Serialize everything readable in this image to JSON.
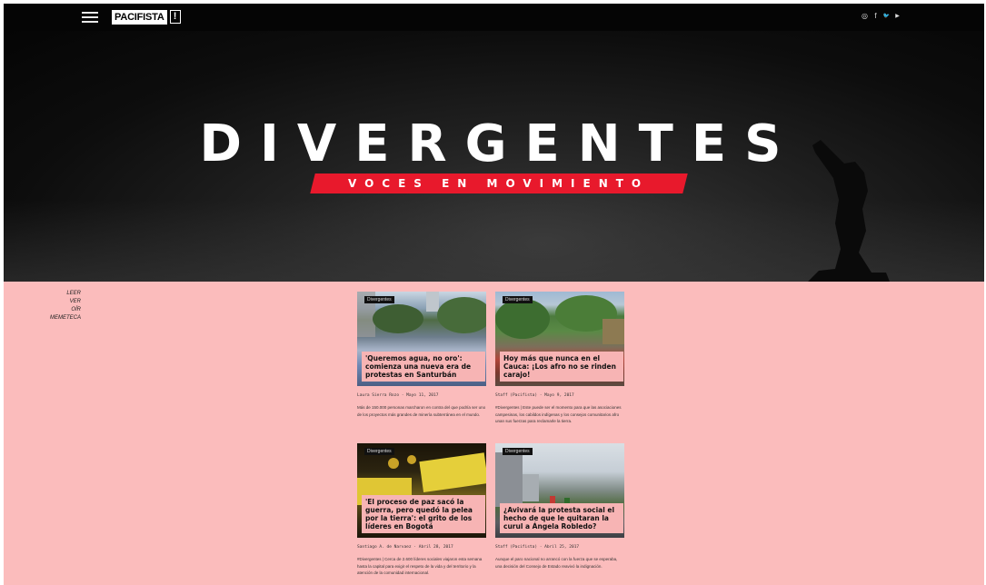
{
  "nav": {
    "logo_text": "PACIFISTA",
    "logo_mark": "!",
    "menu_icon": "hamburger-menu-icon",
    "social": [
      {
        "name": "instagram-icon",
        "glyph": "◎"
      },
      {
        "name": "facebook-icon",
        "glyph": "f"
      },
      {
        "name": "twitter-icon",
        "glyph": "🐦"
      },
      {
        "name": "youtube-icon",
        "glyph": "▶"
      }
    ]
  },
  "hero": {
    "title": "DIVERGENTES",
    "subtitle": "VOCES EN MOVIMIENTO"
  },
  "side_nav": [
    "LEER",
    "VER",
    "OÍR",
    "MEMETECA"
  ],
  "cards": [
    {
      "tag": "Divergentes",
      "headline": "'Queremos agua, no oro': comienza una nueva era de protestas en Santurbán",
      "meta": "Laura Sierra Rozo · Mayo 11, 2017",
      "excerpt": "Más de 150.000 personas marcharon en contra del que podría ser uno de los proyectos más grandes de minería subterránea en el mundo."
    },
    {
      "tag": "Divergentes",
      "headline": "Hoy más que nunca en el Cauca: ¡Los afro no se rinden carajo!",
      "meta": "Staff (Pacifista) · Mayo 9, 2017",
      "excerpt": "#Divergentes | Este puede ser el momento para que las asociaciones campesinas, los cabildos indígenas y los consejos comunitarios afro unan sus fuerzas para reclamarle la tierra."
    },
    {
      "tag": "Divergentes",
      "headline": "'El proceso de paz sacó la guerra, pero quedó la pelea por la tierra': el grito de los líderes en Bogotá",
      "meta": "Santiago A. de Narvaez · Abril 28, 2017",
      "excerpt": "#Divergentes | Cerca de 2.600 líderes sociales viajaron esta semana hasta la capital para exigir el respeto de la vida y del territorio y la atención de la comunidad internacional."
    },
    {
      "tag": "Divergentes",
      "headline": "¿Avivará la protesta social el hecho de que le quitaran la curul a Ángela Robledo?",
      "meta": "Staff (Pacifista) · Abril 25, 2017",
      "excerpt": "Aunque el paro nacional no arrancó con la fuerza que se esperaba, una decisión del Consejo de Estado reavivó la indignación."
    }
  ],
  "colors": {
    "background": "#fbbcbc",
    "topbar": "#050505",
    "accent_red": "#e8192c",
    "headline_bg": "#f7b4b4"
  }
}
